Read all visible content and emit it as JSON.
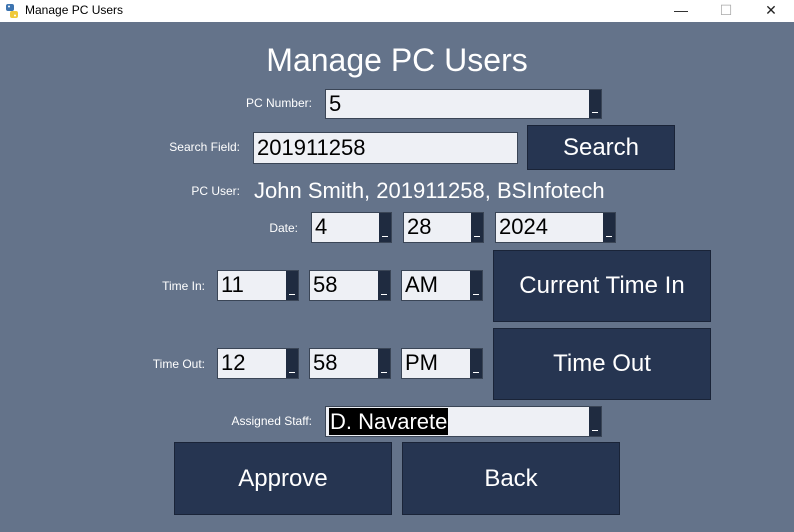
{
  "window": {
    "title": "Manage PC Users",
    "minimize": "—",
    "maximize": "☐",
    "close": "✕"
  },
  "heading": "Manage PC Users",
  "pc_number": {
    "label": "PC Number:",
    "value": "5"
  },
  "search": {
    "label": "Search Field:",
    "value": "201911258",
    "button": "Search"
  },
  "pc_user": {
    "label": "PC User:",
    "value": "John Smith, 201911258, BSInfotech"
  },
  "date": {
    "label": "Date:",
    "month": "4",
    "day": "28",
    "year": "2024"
  },
  "time_in": {
    "label": "Time In:",
    "hour": "11",
    "minute": "58",
    "ampm": "AM",
    "button": "Current Time In"
  },
  "time_out": {
    "label": "Time Out:",
    "hour": "12",
    "minute": "58",
    "ampm": "PM",
    "button": "Time Out"
  },
  "staff": {
    "label": "Assigned Staff:",
    "value": "D. Navarete"
  },
  "actions": {
    "approve": "Approve",
    "back": "Back"
  },
  "colors": {
    "background": "#64738a",
    "button": "#263551",
    "field": "#eef0f5"
  }
}
